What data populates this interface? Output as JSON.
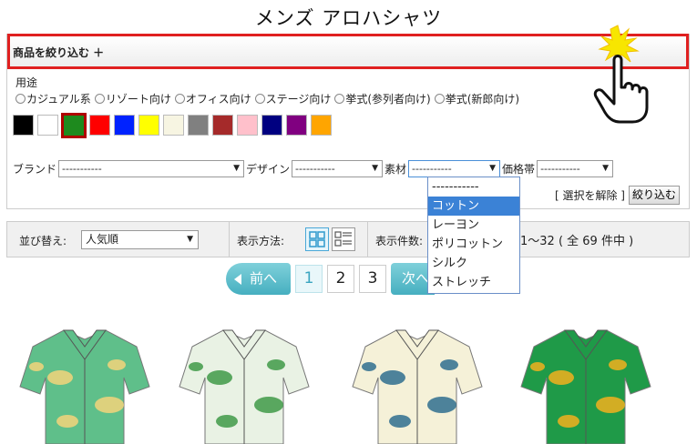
{
  "title": "メンズ アロハシャツ",
  "filter": {
    "header": "商品を絞り込む ＋",
    "usage_label": "用途",
    "usage_options": [
      "カジュアル系",
      "リゾート向け",
      "オフィス向け",
      "ステージ向け",
      "挙式(参列者向け)",
      "挙式(新郎向け)"
    ],
    "colors": [
      "#000000",
      "#ffffff",
      "#1e8a1e",
      "#ff0000",
      "#0022ff",
      "#ffff00",
      "#f7f5e2",
      "#808080",
      "#a52a2a",
      "#ffc0cb",
      "#000080",
      "#800080",
      "#ffa500"
    ],
    "selected_color_index": 2,
    "brand_label": "ブランド",
    "brand_value": "-----------",
    "design_label": "デザイン",
    "design_value": "-----------",
    "material_label": "素材",
    "material_value": "-----------",
    "price_label": "価格帯",
    "price_value": "-----------",
    "clear_label": "[ 選択を解除 ]",
    "apply_label": "絞り込む"
  },
  "material_dropdown": {
    "options": [
      "-----------",
      "コットン",
      "レーヨン",
      "ポリコットン",
      "シルク",
      "ストレッチ"
    ],
    "highlighted_index": 1
  },
  "sort_bar": {
    "sort_label": "並び替え:",
    "sort_value": "人気順",
    "view_label": "表示方法:",
    "count_label": "表示件数:",
    "range_text": "1～32 ( 全 69 件中 )"
  },
  "pagination": {
    "prev_label": "前へ",
    "pages": [
      "1",
      "2",
      "3"
    ],
    "current": "1",
    "next_label": "次へ"
  },
  "products": [
    {
      "name": "product-1",
      "base": "#5fbf8a",
      "accent": "#f3d37a"
    },
    {
      "name": "product-2",
      "base": "#e9f2e4",
      "accent": "#3f9a48"
    },
    {
      "name": "product-3",
      "base": "#f5f1d8",
      "accent": "#2f6f8f"
    },
    {
      "name": "product-4",
      "base": "#1f9a48",
      "accent": "#f2b01e"
    }
  ]
}
